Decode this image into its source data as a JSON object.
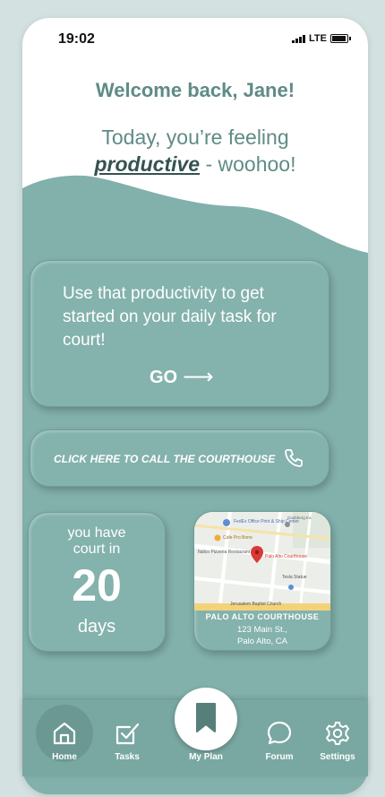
{
  "status": {
    "time": "19:02",
    "network": "LTE"
  },
  "greeting": {
    "welcome": "Welcome back, Jane!",
    "feeling_prefix": "Today, you’re feeling",
    "mood": "productive",
    "feeling_suffix": " - woohoo!"
  },
  "task_card": {
    "text": "Use that productivity to get started on your daily task for court!",
    "go_label": "GO",
    "go_arrow": "⟶"
  },
  "call_card": {
    "text": "CLICK HERE TO CALL THE COURTHOUSE",
    "icon": "phone-icon"
  },
  "countdown": {
    "prefix": "you have court in",
    "days": "20",
    "suffix": "days"
  },
  "courthouse": {
    "name": "PALO ALTO COURTHOUSE",
    "address_line1": "123 Main St.,",
    "address_line2": "Palo Alto, CA",
    "map_labels": {
      "pin": "Palo Alto Courthouse",
      "print": "FedEx Office Print & Ship Center",
      "pizza": "Italico Pizzeria Restaurant",
      "cafe": "Cafe Pro Bono",
      "tesla": "Tesla Statue",
      "church": "Jerusalem Baptist Church",
      "top": "Godsberg Inc"
    }
  },
  "nav": {
    "items": [
      {
        "label": "Home",
        "icon": "home-icon"
      },
      {
        "label": "Tasks",
        "icon": "tasks-icon"
      },
      {
        "label": "My Plan",
        "icon": "bookmark-icon"
      },
      {
        "label": "Forum",
        "icon": "chat-icon"
      },
      {
        "label": "Settings",
        "icon": "gear-icon"
      }
    ]
  },
  "colors": {
    "teal": "#82b0ab",
    "heading": "#5f8b86",
    "mood": "#35524f",
    "pin": "#d93a35"
  }
}
